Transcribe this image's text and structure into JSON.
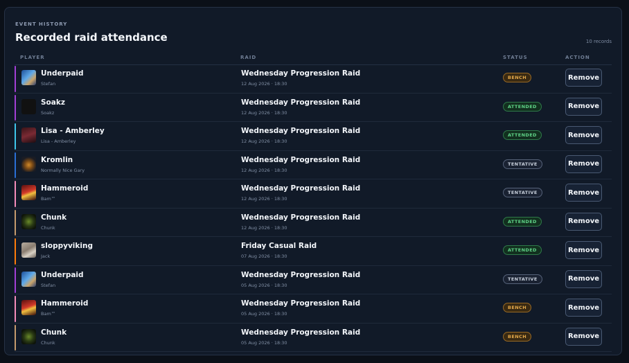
{
  "header": {
    "eyebrow": "EVENT HISTORY",
    "title": "Recorded raid attendance",
    "count": "10 records"
  },
  "columns": {
    "player": "PLAYER",
    "raid": "RAID",
    "status": "STATUS",
    "action": "ACTION"
  },
  "rows": [
    {
      "player": "Underpaid",
      "sub": "Stefan",
      "raid": "Wednesday Progression Raid",
      "date": "12 Aug 2026 · 18:30",
      "status": "BENCH",
      "status_type": "bench",
      "action": "Remove",
      "stripe_color": "#a33fd6",
      "avatar": "blue"
    },
    {
      "player": "Soakz",
      "sub": "Soakz",
      "raid": "Wednesday Progression Raid",
      "date": "12 Aug 2026 · 18:30",
      "status": "ATTENDED",
      "status_type": "attended",
      "action": "Remove",
      "stripe_color": "#a33fd6",
      "avatar": "text-badge"
    },
    {
      "player": "Lisa - Amberley",
      "sub": "Lisa - Amberley",
      "raid": "Wednesday Progression Raid",
      "date": "12 Aug 2026 · 18:30",
      "status": "ATTENDED",
      "status_type": "attended",
      "action": "Remove",
      "stripe_color": "#3fc7eb",
      "avatar": "dark-red"
    },
    {
      "player": "Kromlin",
      "sub": "Normally Nice Gary",
      "raid": "Wednesday Progression Raid",
      "date": "12 Aug 2026 · 18:30",
      "status": "TENTATIVE",
      "status_type": "tentative",
      "action": "Remove",
      "stripe_color": "#2a6fd6",
      "avatar": "emblem"
    },
    {
      "player": "Hammeroid",
      "sub": "Bam™",
      "raid": "Wednesday Progression Raid",
      "date": "12 Aug 2026 · 18:30",
      "status": "TENTATIVE",
      "status_type": "tentative",
      "action": "Remove",
      "stripe_color": "#f48cba",
      "avatar": "red"
    },
    {
      "player": "Chunk",
      "sub": "Chunk",
      "raid": "Wednesday Progression Raid",
      "date": "12 Aug 2026 · 18:30",
      "status": "ATTENDED",
      "status_type": "attended",
      "action": "Remove",
      "stripe_color": "#c69b6d",
      "avatar": "green"
    },
    {
      "player": "sloppyviking",
      "sub": "Jack",
      "raid": "Friday Casual Raid",
      "date": "07 Aug 2026 · 18:30",
      "status": "ATTENDED",
      "status_type": "attended",
      "action": "Remove",
      "stripe_color": "#ff7c0a",
      "avatar": "light"
    },
    {
      "player": "Underpaid",
      "sub": "Stefan",
      "raid": "Wednesday Progression Raid",
      "date": "05 Aug 2026 · 18:30",
      "status": "TENTATIVE",
      "status_type": "tentative",
      "action": "Remove",
      "stripe_color": "#a33fd6",
      "avatar": "blue"
    },
    {
      "player": "Hammeroid",
      "sub": "Bam™",
      "raid": "Wednesday Progression Raid",
      "date": "05 Aug 2026 · 18:30",
      "status": "BENCH",
      "status_type": "bench",
      "action": "Remove",
      "stripe_color": "#f48cba",
      "avatar": "red"
    },
    {
      "player": "Chunk",
      "sub": "Chunk",
      "raid": "Wednesday Progression Raid",
      "date": "05 Aug 2026 · 18:30",
      "status": "BENCH",
      "status_type": "bench",
      "action": "Remove",
      "stripe_color": "#c69b6d",
      "avatar": "green"
    }
  ]
}
